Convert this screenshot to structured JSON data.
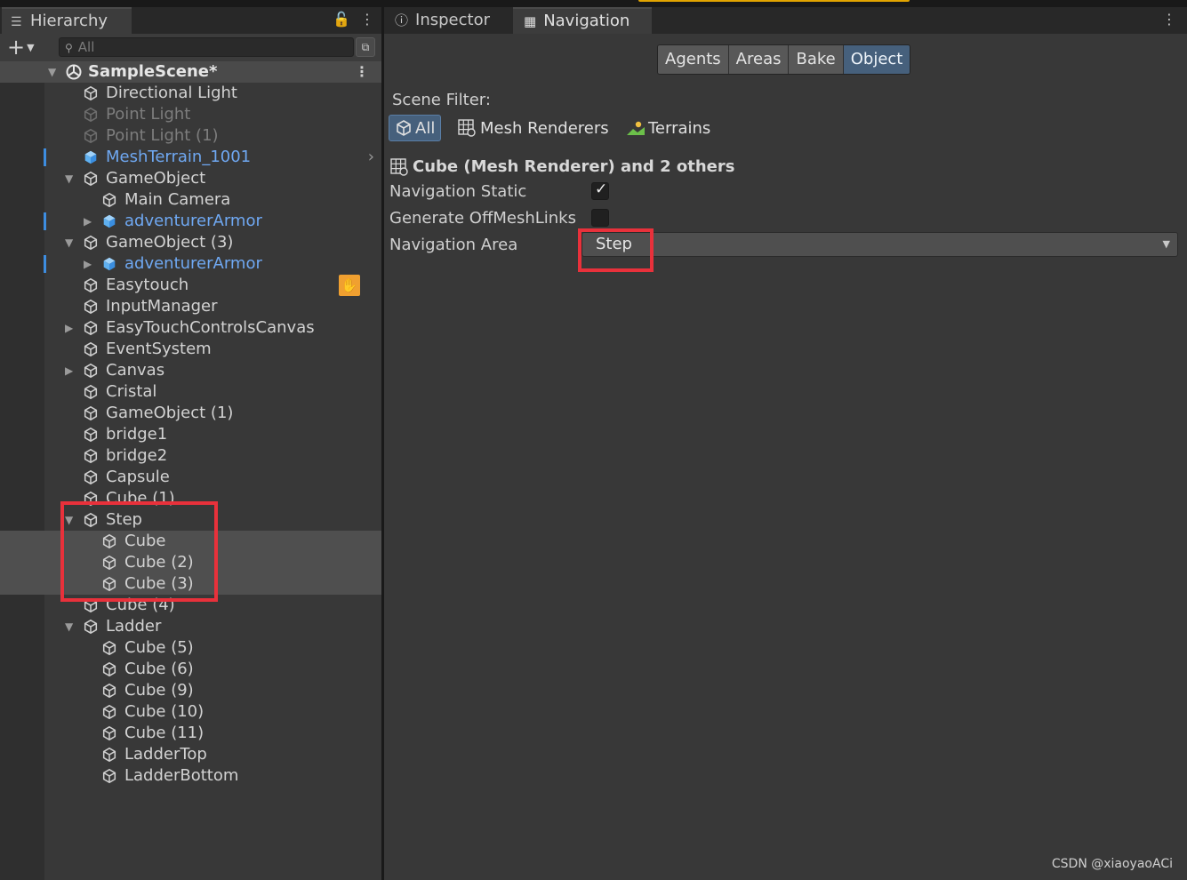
{
  "hierarchy": {
    "tab_label": "Hierarchy",
    "add_label": "+",
    "search_placeholder": "All",
    "scene_name": "SampleScene*",
    "items": [
      {
        "label": "Directional Light",
        "depth": 0,
        "expand": "",
        "state": "normal"
      },
      {
        "label": "Point Light",
        "depth": 0,
        "expand": "",
        "state": "dim"
      },
      {
        "label": "Point Light (1)",
        "depth": 0,
        "expand": "",
        "state": "dim"
      },
      {
        "label": "MeshTerrain_1001",
        "depth": 0,
        "expand": "",
        "state": "prefab"
      },
      {
        "label": "GameObject",
        "depth": 0,
        "expand": "open",
        "state": "normal"
      },
      {
        "label": "Main Camera",
        "depth": 1,
        "expand": "",
        "state": "normal"
      },
      {
        "label": "adventurerArmor",
        "depth": 1,
        "expand": "closed",
        "state": "prefab"
      },
      {
        "label": "GameObject (3)",
        "depth": 0,
        "expand": "open",
        "state": "normal"
      },
      {
        "label": "adventurerArmor",
        "depth": 1,
        "expand": "closed",
        "state": "prefab"
      },
      {
        "label": "Easytouch",
        "depth": 0,
        "expand": "",
        "state": "normal"
      },
      {
        "label": "InputManager",
        "depth": 0,
        "expand": "",
        "state": "normal"
      },
      {
        "label": "EasyTouchControlsCanvas",
        "depth": 0,
        "expand": "closed",
        "state": "normal"
      },
      {
        "label": "EventSystem",
        "depth": 0,
        "expand": "",
        "state": "normal"
      },
      {
        "label": "Canvas",
        "depth": 0,
        "expand": "closed",
        "state": "normal"
      },
      {
        "label": "Cristal",
        "depth": 0,
        "expand": "",
        "state": "normal"
      },
      {
        "label": "GameObject (1)",
        "depth": 0,
        "expand": "",
        "state": "normal"
      },
      {
        "label": "bridge1",
        "depth": 0,
        "expand": "",
        "state": "normal"
      },
      {
        "label": "bridge2",
        "depth": 0,
        "expand": "",
        "state": "normal"
      },
      {
        "label": "Capsule",
        "depth": 0,
        "expand": "",
        "state": "normal"
      },
      {
        "label": "Cube (1)",
        "depth": 0,
        "expand": "",
        "state": "normal"
      },
      {
        "label": "Step",
        "depth": 0,
        "expand": "open",
        "state": "normal"
      },
      {
        "label": "Cube",
        "depth": 1,
        "expand": "",
        "state": "selected"
      },
      {
        "label": "Cube (2)",
        "depth": 1,
        "expand": "",
        "state": "selected"
      },
      {
        "label": "Cube (3)",
        "depth": 1,
        "expand": "",
        "state": "selected"
      },
      {
        "label": "Cube (4)",
        "depth": 0,
        "expand": "",
        "state": "normal"
      },
      {
        "label": "Ladder",
        "depth": 0,
        "expand": "open",
        "state": "normal"
      },
      {
        "label": "Cube (5)",
        "depth": 1,
        "expand": "",
        "state": "normal"
      },
      {
        "label": "Cube (6)",
        "depth": 1,
        "expand": "",
        "state": "normal"
      },
      {
        "label": "Cube (9)",
        "depth": 1,
        "expand": "",
        "state": "normal"
      },
      {
        "label": "Cube (10)",
        "depth": 1,
        "expand": "",
        "state": "normal"
      },
      {
        "label": "Cube (11)",
        "depth": 1,
        "expand": "",
        "state": "normal"
      },
      {
        "label": "LadderTop",
        "depth": 1,
        "expand": "",
        "state": "normal"
      },
      {
        "label": "LadderBottom",
        "depth": 1,
        "expand": "",
        "state": "normal"
      }
    ]
  },
  "tabs": {
    "inspector": "Inspector",
    "navigation": "Navigation"
  },
  "navigation": {
    "modes": [
      "Agents",
      "Areas",
      "Bake",
      "Object"
    ],
    "active_mode": "Object",
    "scene_filter_label": "Scene Filter:",
    "filters": [
      "All",
      "Mesh Renderers",
      "Terrains"
    ],
    "active_filter": "All",
    "selection_title": "Cube (Mesh Renderer) and 2 others",
    "static_label": "Navigation Static",
    "static_checked": true,
    "offmesh_label": "Generate OffMeshLinks",
    "offmesh_checked": false,
    "area_label": "Navigation Area",
    "area_value": "Step"
  },
  "colors": {
    "accent_selected": "#46607c",
    "prefab_text": "#6fa8f2",
    "highlight_box": "#e8313b",
    "top_accent": "#e2a400"
  },
  "watermark": "CSDN @xiaoyaoACi"
}
